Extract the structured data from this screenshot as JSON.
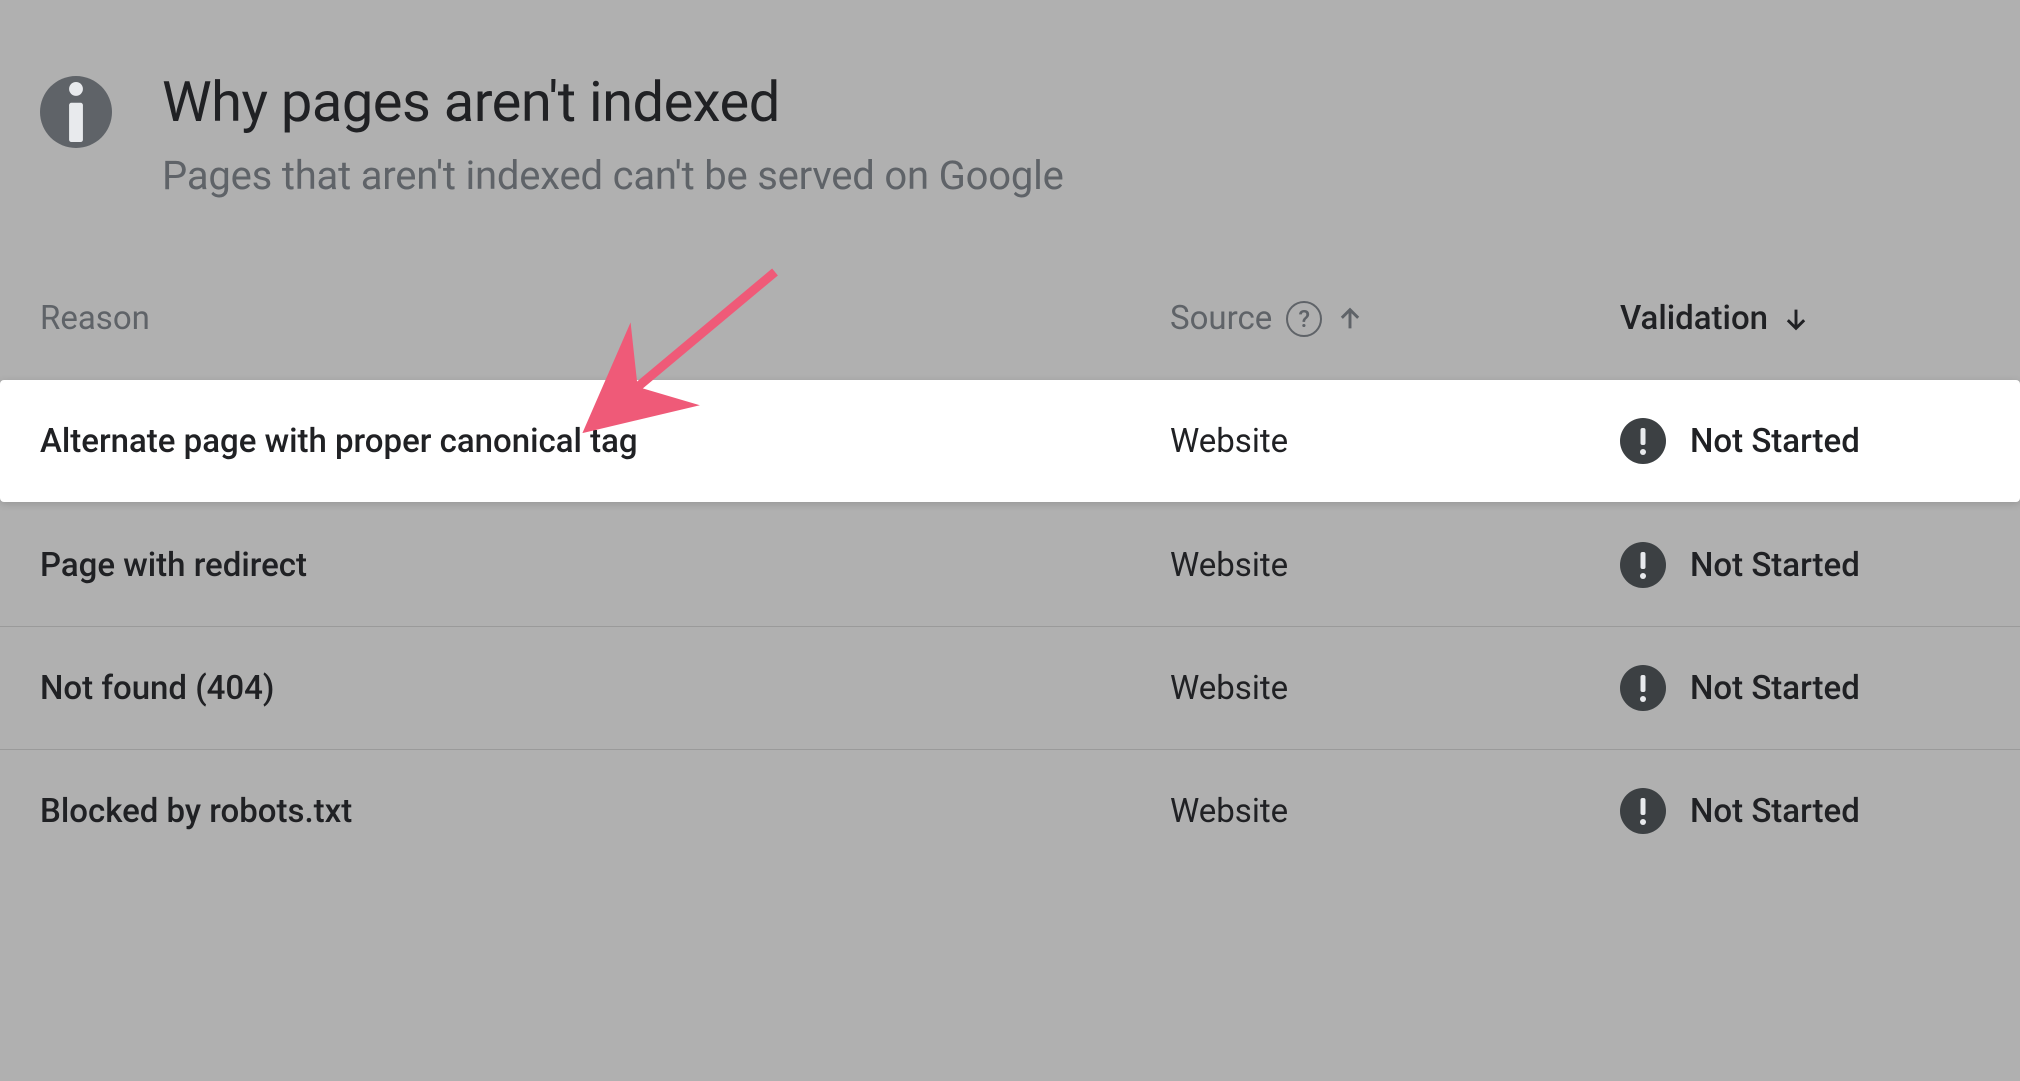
{
  "header": {
    "title": "Why pages aren't indexed",
    "subtitle": "Pages that aren't indexed can't be served on Google"
  },
  "columns": {
    "reason": "Reason",
    "source": "Source",
    "validation": "Validation"
  },
  "rows": [
    {
      "reason": "Alternate page with proper canonical tag",
      "source": "Website",
      "validation": "Not Started",
      "highlighted": true
    },
    {
      "reason": "Page with redirect",
      "source": "Website",
      "validation": "Not Started",
      "highlighted": false
    },
    {
      "reason": "Not found (404)",
      "source": "Website",
      "validation": "Not Started",
      "highlighted": false
    },
    {
      "reason": "Blocked by robots.txt",
      "source": "Website",
      "validation": "Not Started",
      "highlighted": false
    }
  ]
}
